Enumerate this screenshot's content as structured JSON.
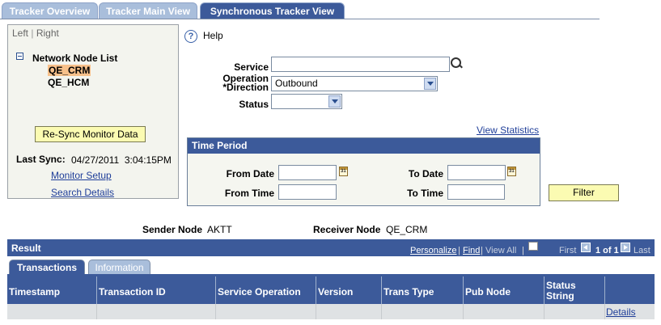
{
  "tabs": [
    {
      "label": "Tracker Overview",
      "active": false
    },
    {
      "label": "Tracker Main View",
      "active": false
    },
    {
      "label": "Synchronous Tracker View",
      "active": true
    }
  ],
  "left_panel": {
    "left": "Left",
    "sep": "|",
    "right": "Right",
    "tree_title": "Network Node List",
    "nodes": [
      "QE_CRM",
      "QE_HCM"
    ],
    "resync_button": "Re-Sync Monitor Data",
    "last_sync_label": "Last Sync:",
    "last_sync_value": "04/27/2011  3:04:15PM",
    "monitor_setup": "Monitor Setup",
    "search_details": "Search Details"
  },
  "help": {
    "label": "Help",
    "icon": "?"
  },
  "form": {
    "service_operation_label": "Service Operation",
    "service_operation_value": "",
    "direction_label": "*Direction",
    "direction_value": "Outbound",
    "status_label": "Status",
    "status_value": ""
  },
  "view_statistics": "View Statistics",
  "time_period": {
    "title": "Time Period",
    "from_date_label": "From Date",
    "to_date_label": "To Date",
    "from_time_label": "From Time",
    "to_time_label": "To Time",
    "from_date": "",
    "to_date": "",
    "from_time": "",
    "to_time": ""
  },
  "filter_button": "Filter",
  "sender_label": "Sender Node",
  "sender_value": "AKTT",
  "receiver_label": "Receiver Node",
  "receiver_value": "QE_CRM",
  "result": {
    "title": "Result",
    "personalize": "Personalize",
    "bar_sep": "|",
    "find": "Find",
    "view_all": "View All",
    "first": "First",
    "count": "1 of 1",
    "last": "Last"
  },
  "subtabs": [
    {
      "label": "Transactions",
      "active": true
    },
    {
      "label": "Information",
      "active": false
    }
  ],
  "columns": [
    "Timestamp",
    "Transaction ID",
    "Service Operation",
    "Version",
    "Trans Type",
    "Pub Node",
    "Status String"
  ],
  "row_link": "Details",
  "colors": {
    "header_blue": "#3c5a9a",
    "tab_light": "#a9bedb",
    "button_yellow": "#fbfbb2",
    "link": "#1f3e99"
  }
}
